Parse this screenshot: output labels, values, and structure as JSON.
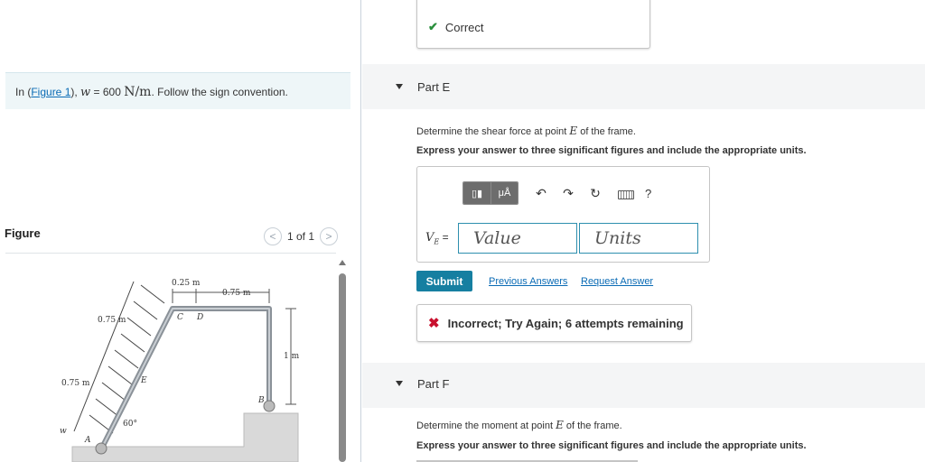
{
  "problem": {
    "prefix": "In (",
    "figure_link": "Figure 1",
    "middle": "), ",
    "var": "w",
    "equals": " = 600 ",
    "unit": "N/m",
    "suffix": ". Follow the sign convention."
  },
  "figure_panel": {
    "title": "Figure",
    "pager_text": "1 of 1",
    "prev_glyph": "<",
    "next_glyph": ">",
    "labels": {
      "dim_top_cd": "0.25 m",
      "dim_top_right": "0.75 m",
      "dim_upper_left": "0.75 m",
      "dim_lower_left": "0.75 m",
      "dim_right": "1 m",
      "pt_c": "C",
      "pt_d": "D",
      "pt_e": "E",
      "pt_b": "B",
      "pt_a": "A",
      "angle": "60°",
      "load": "w"
    }
  },
  "prev_feedback": {
    "check_glyph": "✔",
    "text": "Correct"
  },
  "part_e": {
    "title": "Part E",
    "question_prefix": "Determine the shear force at point ",
    "question_var": "E",
    "question_suffix": " of the frame.",
    "instruction": "Express your answer to three significant figures and include the appropriate units.",
    "toolbar": {
      "templates_glyph": "▯▮",
      "units_glyph": "μÅ",
      "undo_glyph": "↶",
      "redo_glyph": "↷",
      "reset_glyph": "↻",
      "help_glyph": "?"
    },
    "answer_var": "V",
    "answer_sub": "E",
    "answer_eq": " =",
    "value_placeholder": "Value",
    "units_placeholder": "Units",
    "submit_label": "Submit",
    "prev_answers_label": "Previous Answers",
    "request_answer_label": "Request Answer",
    "feedback_glyph": "✖",
    "feedback_text": "Incorrect; Try Again; 6 attempts remaining"
  },
  "part_f": {
    "title": "Part F",
    "question_prefix": "Determine the moment at point ",
    "question_var": "E",
    "question_suffix": " of the frame.",
    "instruction": "Express your answer to three significant figures and include the appropriate units."
  }
}
